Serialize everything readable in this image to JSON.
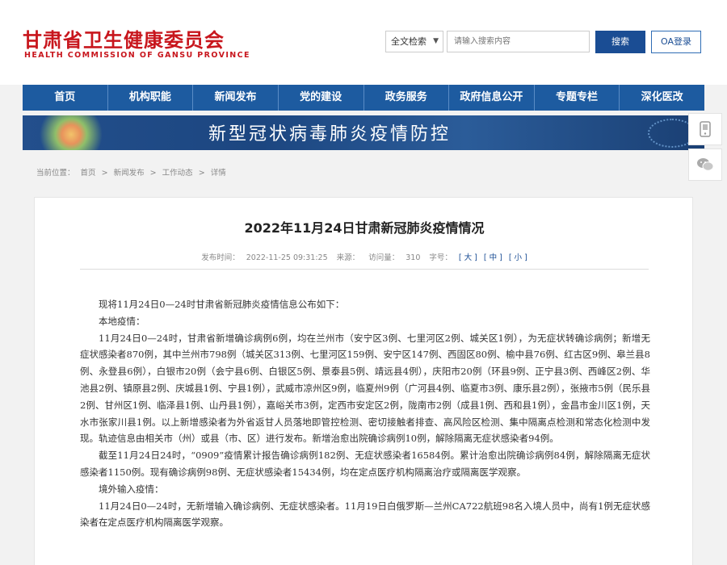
{
  "site": {
    "name_cn": "甘肃省卫生健康委员会",
    "name_en": "HEALTH COMMISSION OF GANSU PROVINCE"
  },
  "search": {
    "scope": "全文检索",
    "placeholder": "请输入搜索内容",
    "button": "搜索",
    "oa_login": "OA登录"
  },
  "nav": [
    "首页",
    "机构职能",
    "新闻发布",
    "党的建设",
    "政务服务",
    "政府信息公开",
    "专题专栏",
    "深化医改"
  ],
  "banner": {
    "title": "新型冠状病毒肺炎疫情防控"
  },
  "breadcrumb": [
    "当前位置：",
    "首页",
    ">",
    "新闻发布",
    ">",
    "工作动态",
    ">",
    "详情"
  ],
  "article": {
    "title": "2022年11月24日甘肃新冠肺炎疫情情况",
    "meta": {
      "publish_label": "发布时间：",
      "publish_time": "2022-11-25 09:31:25",
      "source_label": "来源：",
      "visits_label": "访问量：",
      "visits": "310",
      "fontsize_label": "字号：",
      "large": "[ 大 ]",
      "medium": "[ 中 ]",
      "small": "[ 小 ]"
    },
    "paragraphs": [
      "现将11月24日0—24时甘肃省新冠肺炎疫情信息公布如下：",
      "本地疫情：",
      "11月24日0—24时，甘肃省新增确诊病例6例，均在兰州市（安宁区3例、七里河区2例、城关区1例），为无症状转确诊病例；新增无症状感染者870例，其中兰州市798例（城关区313例、七里河区159例、安宁区147例、西固区80例、榆中县76例、红古区9例、皋兰县8例、永登县6例），白银市20例（会宁县6例、白银区5例、景泰县5例、靖远县4例），庆阳市20例（环县9例、正宁县3例、西峰区2例、华池县2例、镇原县2例、庆城县1例、宁县1例），武威市凉州区9例，临夏州9例（广河县4例、临夏市3例、康乐县2例），张掖市5例（民乐县2例、甘州区1例、临泽县1例、山丹县1例），嘉峪关市3例，定西市安定区2例，陇南市2例（成县1例、西和县1例），金昌市金川区1例，天水市张家川县1例。以上新增感染者为外省返甘人员落地即管控检测、密切接触者排查、高风险区检测、集中隔离点检测和常态化检测中发现。轨迹信息由相关市（州）或县（市、区）进行发布。新增治愈出院确诊病例10例，解除隔离无症状感染者94例。",
      "截至11月24日24时，“0909”疫情累计报告确诊病例182例、无症状感染者16584例。累计治愈出院确诊病例84例，解除隔离无症状感染者1150例。现有确诊病例98例、无症状感染者15434例，均在定点医疗机构隔离治疗或隔离医学观察。",
      "境外输入疫情：",
      "11月24日0—24时，无新增输入确诊病例、无症状感染者。11月19日白俄罗斯—兰州CA722航班98名入境人员中，尚有1例无症状感染者在定点医疗机构隔离医学观察。"
    ]
  },
  "side_tools": [
    "mobile-icon",
    "wechat-icon"
  ],
  "colors": {
    "brand_red": "#c8161d",
    "nav_blue": "#1d5ba0",
    "button_blue": "#1a4d94"
  }
}
